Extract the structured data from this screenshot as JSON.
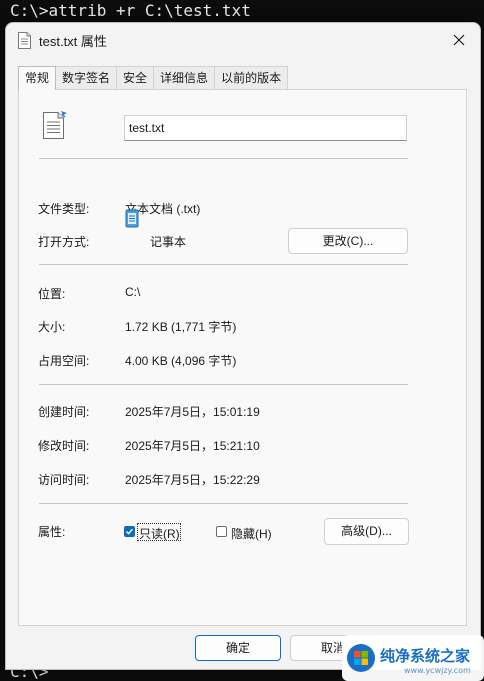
{
  "console": {
    "command_line": "C:\\>attrib +r C:\\test.txt",
    "bottom_prompt": "C:\\>"
  },
  "dialog": {
    "title": "test.txt 属性",
    "tabs": [
      {
        "label": "常规",
        "active": true
      },
      {
        "label": "数字签名",
        "active": false
      },
      {
        "label": "安全",
        "active": false
      },
      {
        "label": "详细信息",
        "active": false
      },
      {
        "label": "以前的版本",
        "active": false
      }
    ],
    "filename": "test.txt",
    "file_type": {
      "label": "文件类型:",
      "value": "文本文档 (.txt)"
    },
    "opens_with": {
      "label": "打开方式:",
      "value": "记事本",
      "button": "更改(C)..."
    },
    "location": {
      "label": "位置:",
      "value": "C:\\"
    },
    "size": {
      "label": "大小:",
      "value": "1.72 KB (1,771 字节)"
    },
    "size_on_disk": {
      "label": "占用空间:",
      "value": "4.00 KB (4,096 字节)"
    },
    "created": {
      "label": "创建时间:",
      "value": "2025年7月5日，15:01:19"
    },
    "modified": {
      "label": "修改时间:",
      "value": "2025年7月5日，15:21:10"
    },
    "accessed": {
      "label": "访问时间:",
      "value": "2025年7月5日，15:22:29"
    },
    "attributes": {
      "label": "属性:",
      "readonly": {
        "label": "只读(R)",
        "checked": true
      },
      "hidden": {
        "label": "隐藏(H)",
        "checked": false
      },
      "advanced_button": "高级(D)..."
    },
    "footer": {
      "ok": "确定",
      "cancel": "取消"
    }
  },
  "watermark": {
    "text": "纯净系统之家",
    "sub": "www.ycwjzy.com"
  },
  "colors": {
    "accent": "#0f6cbd",
    "panel": "#f9f9f9",
    "dialog": "#f3f3f3",
    "console_bg": "#0c0c0c"
  }
}
